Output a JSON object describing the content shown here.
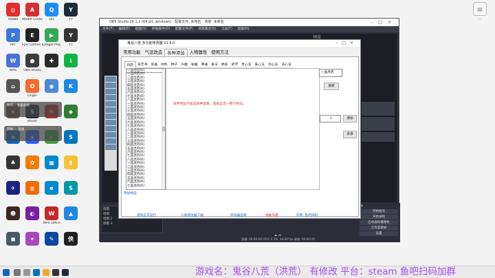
{
  "desktop": {
    "icons": [
      {
        "label": "Adobe",
        "color": "#e02d2d",
        "glyph": "◎"
      },
      {
        "label": "Adobe Creati...",
        "color": "#d0312d",
        "glyph": "A"
      },
      {
        "label": "QQ",
        "color": "#1f8ef1",
        "glyph": "Q"
      },
      {
        "label": "YY",
        "color": "#1f2a3a",
        "glyph": "Y"
      },
      {
        "label": "PPT",
        "color": "#3b78d8",
        "glyph": "P"
      },
      {
        "label": "Epic Games Launcher",
        "color": "#222222",
        "glyph": "E"
      },
      {
        "label": "Google Play",
        "color": "#34a853",
        "glyph": "▶"
      },
      {
        "label": "YY",
        "color": "#333333",
        "glyph": "Y"
      },
      {
        "label": "WPS",
        "color": "#4a6fd8",
        "glyph": "W"
      },
      {
        "label": "OBS Studio",
        "color": "#3d3d3d",
        "glyph": "●"
      },
      {
        "label": "",
        "color": "#2a2a2a",
        "glyph": "✚"
      },
      {
        "label": "",
        "color": "#12b345",
        "glyph": "i"
      },
      {
        "label": "",
        "color": "#555555",
        "glyph": "⌂"
      },
      {
        "label": "Origin",
        "color": "#f56c2d",
        "glyph": "O"
      },
      {
        "label": "",
        "color": "#4a8ad6",
        "glyph": "◉"
      },
      {
        "label": "",
        "color": "#1e88e5",
        "glyph": "K"
      },
      {
        "label": "",
        "color": "#6d4c41",
        "glyph": "★"
      },
      {
        "label": "steam",
        "color": "#1b2838",
        "glyph": "S"
      },
      {
        "label": "",
        "color": "#c62828",
        "glyph": "✉"
      },
      {
        "label": "",
        "color": "#2e7d32",
        "glyph": "◆"
      },
      {
        "label": "",
        "color": "#1565c0",
        "glyph": "⊕"
      },
      {
        "label": "",
        "color": "#2962ff",
        "glyph": "◈"
      },
      {
        "label": "",
        "color": "#43a047",
        "glyph": "✓"
      },
      {
        "label": "",
        "color": "#0277bd",
        "glyph": "S"
      },
      {
        "label": "",
        "color": "#333333",
        "glyph": "♣"
      },
      {
        "label": "",
        "color": "#f57c00",
        "glyph": "✿"
      },
      {
        "label": "",
        "color": "#0288d1",
        "glyph": "▦"
      },
      {
        "label": "",
        "color": "#fbc02d",
        "glyph": "▮"
      },
      {
        "label": "",
        "color": "#1a237e",
        "glyph": "✈"
      },
      {
        "label": "",
        "color": "#ef6c00",
        "glyph": "◍"
      },
      {
        "label": "",
        "color": "#0288d1",
        "glyph": "e"
      },
      {
        "label": "",
        "color": "#0097a7",
        "glyph": "S"
      },
      {
        "label": "",
        "color": "#3e2723",
        "glyph": "☻"
      },
      {
        "label": "",
        "color": "#7b1fa2",
        "glyph": "◐"
      },
      {
        "label": "WPS Office",
        "color": "#c62828",
        "glyph": "W"
      },
      {
        "label": "",
        "color": "#1e88e5",
        "glyph": "▲"
      },
      {
        "label": "",
        "color": "#455a64",
        "glyph": "◼"
      },
      {
        "label": "",
        "color": "#ab47bc",
        "glyph": "✦"
      },
      {
        "label": "",
        "color": "#0d47a1",
        "glyph": "✎"
      },
      {
        "label": "",
        "color": "#212121",
        "glyph": "侠"
      }
    ],
    "right_icon_label": "…"
  },
  "toasts": [
    {
      "text": "你的... 准备就绪"
    },
    {
      "text": "开始 ... 直播"
    }
  ],
  "obs": {
    "title": "OBS Studio 26.1.1 (64 bit, windows) - 配置文件: 未命名 - 场景: 未命名",
    "menu": [
      "文件(F)",
      "编辑(E)",
      "视图(V)",
      "停靠部件(D)",
      "配置文件(P)",
      "场景集合(S)",
      "工具(T)",
      "帮助(H)"
    ],
    "preview_label": "预览",
    "scenes_label": "场景",
    "scene_items": [
      "场景",
      "场景 2",
      "场景 3"
    ],
    "controls_label": "控件",
    "buttons": [
      "开始推流",
      "开始录制",
      "启动虚拟摄像机",
      "工作室模式",
      "设置",
      "退出"
    ],
    "status": "直播: 00:00:00   CPU: 2.3%, 30.00 fps   录制: 00:00:00"
  },
  "trainer": {
    "title": "鬼谷八荒 多功能修改器 V1.6.0",
    "tabs": [
      "常用功能",
      "气运改造",
      "各种添加",
      "人物属性",
      "使用方法"
    ],
    "active_tab": 2,
    "sub_tabs": [
      "丹药",
      "技艺书",
      "装备",
      "材料",
      "种子",
      "兴趣",
      "秘籍",
      "神通",
      "身法",
      "绝技",
      "武学",
      "灵心法",
      "身心法",
      "功心法",
      "法心法"
    ],
    "active_sub_tab": 0,
    "list_items": [
      "一品丹药(R)",
      "一品丹药(R)",
      "二品灵药(R)",
      "三品灵药(R)",
      "四品灵药(R)",
      "五品灵药(R)",
      "六品灵药(R)",
      "七品灵药(R)",
      "八品灵药(R)",
      "一品灵丹(R)",
      "二品灵丹(R)",
      "三品灵丹(R)",
      "四品灵丹(R)",
      "五品灵丹(R)",
      "六品灵丹(R)",
      "七品灵丹(R)",
      "八品灵丹(R)",
      "一品灵丹(R)",
      "二品灵丹(R)",
      "三品灵丹(R)",
      "四品灵丹(R)",
      "五品灵丹(R)",
      "六品灵丹(R)",
      "七品灵丹(R)",
      "八品灵丹(R)",
      "一品灵丹(R)",
      "二品灵丹(R)",
      "三品灵丹(R)",
      "四品灵丹(R)",
      "五品灵丹(R)",
      "六品灵丹(R)",
      "七品灵丹(R)"
    ],
    "note": "丢弃物品不能选择种类数，直接全选一整行移动。",
    "search_value": "一品丹药",
    "search_button": "搜索",
    "qty_value": "1",
    "add_button": "添加",
    "multi_button": "多添",
    "bottom_link": "添加物品",
    "footer_links": [
      {
        "text": "游戏正在运行",
        "color": "blue"
      },
      {
        "text": "小窗修改器下载",
        "color": "blue"
      },
      {
        "text": "修改器官网",
        "color": "blue"
      },
      {
        "text": "捐助作者",
        "color": "red"
      },
      {
        "text": "作者: 鱼吧扫码",
        "color": "blue"
      }
    ]
  },
  "banner": "游戏名：鬼谷八荒（洪荒） 有修改 平台：steam 鱼吧扫码加群",
  "colors": {
    "banner": "#a24df0",
    "note_red": "#e53935",
    "link_blue": "#1e66d6"
  }
}
